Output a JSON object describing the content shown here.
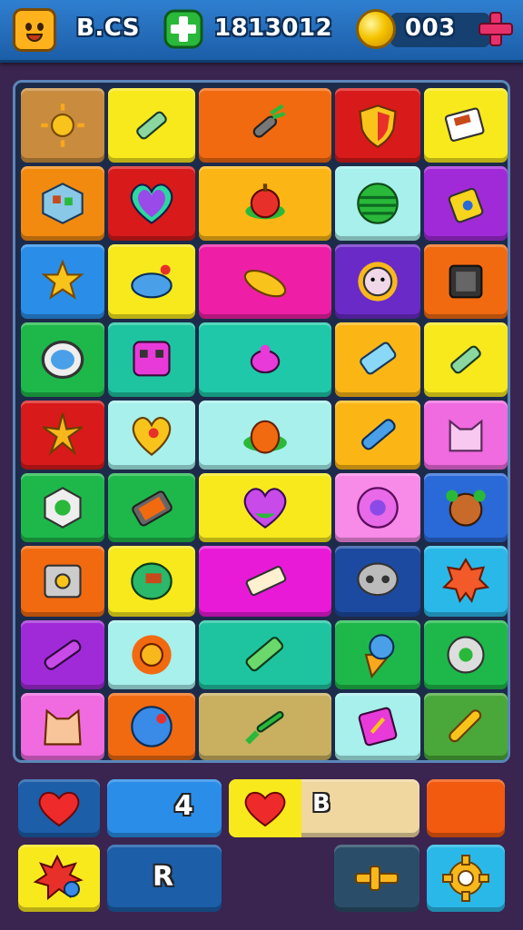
{
  "top_bar": {
    "player_label": "B.CS",
    "score": "1813012",
    "coins": "003"
  },
  "board": {
    "rows": [
      [
        {
          "color": "#c98c3e",
          "icon": "sun"
        },
        {
          "color": "#f8e91c",
          "icon": "tube"
        },
        {
          "color": "#f26a10",
          "icon": "carrot"
        },
        {
          "color": "#d81a1a",
          "icon": "shield"
        },
        {
          "color": "#f8e91c",
          "icon": "book"
        }
      ],
      [
        {
          "color": "#f28a10",
          "icon": "cube"
        },
        {
          "color": "#d81a1a",
          "icon": "heart"
        },
        {
          "color": "#fbb615",
          "icon": "apple"
        },
        {
          "color": "#a7f0ec",
          "icon": "melon"
        },
        {
          "color": "#a02ad8",
          "icon": "bag"
        }
      ],
      [
        {
          "color": "#2a8ee8",
          "icon": "star"
        },
        {
          "color": "#f8e91c",
          "icon": "leaf"
        },
        {
          "color": "#ee1fa6",
          "icon": "candy"
        },
        {
          "color": "#6a2ac8",
          "icon": "sunface"
        },
        {
          "color": "#f26a10",
          "icon": "chip"
        }
      ],
      [
        {
          "color": "#1eb84a",
          "icon": "ring"
        },
        {
          "color": "#1ec4a0",
          "icon": "robot"
        },
        {
          "color": "#1ec8a8",
          "icon": "bug"
        },
        {
          "color": "#fbb615",
          "icon": "tag"
        },
        {
          "color": "#f8e91c",
          "icon": "tube"
        }
      ],
      [
        {
          "color": "#d81a1a",
          "icon": "sparkle"
        },
        {
          "color": "#a7f0ec",
          "icon": "heart2"
        },
        {
          "color": "#a7f0ec",
          "icon": "pumpkin"
        },
        {
          "color": "#fbb615",
          "icon": "pen"
        },
        {
          "color": "#f06ae0",
          "icon": "cat"
        }
      ],
      [
        {
          "color": "#1eb84a",
          "icon": "gem"
        },
        {
          "color": "#1eb84a",
          "icon": "phone"
        },
        {
          "color": "#f8e91c",
          "icon": "heart3"
        },
        {
          "color": "#f88ae8",
          "icon": "donut"
        },
        {
          "color": "#2a6ad8",
          "icon": "monkey"
        }
      ],
      [
        {
          "color": "#f26a10",
          "icon": "button"
        },
        {
          "color": "#f8e91c",
          "icon": "blob"
        },
        {
          "color": "#e81ad8",
          "icon": "bar"
        },
        {
          "color": "#1c4aa0",
          "icon": "skull"
        },
        {
          "color": "#2ab8e8",
          "icon": "gear"
        }
      ],
      [
        {
          "color": "#a02ad8",
          "icon": "pencil"
        },
        {
          "color": "#a7f0ec",
          "icon": "sunflower"
        },
        {
          "color": "#1ec4a0",
          "icon": "gumstick"
        },
        {
          "color": "#1eb84a",
          "icon": "icecream"
        },
        {
          "color": "#1eb84a",
          "icon": "cog"
        }
      ],
      [
        {
          "color": "#f06ae0",
          "icon": "catface"
        },
        {
          "color": "#f26a10",
          "icon": "ball"
        },
        {
          "color": "#c8b060",
          "icon": "broom"
        },
        {
          "color": "#a7f0ec",
          "icon": "card"
        },
        {
          "color": "#4aa83a",
          "icon": "stick"
        }
      ]
    ]
  },
  "bottom": {
    "lives_value": "4",
    "hearts_value": "B",
    "key_label": "R"
  }
}
